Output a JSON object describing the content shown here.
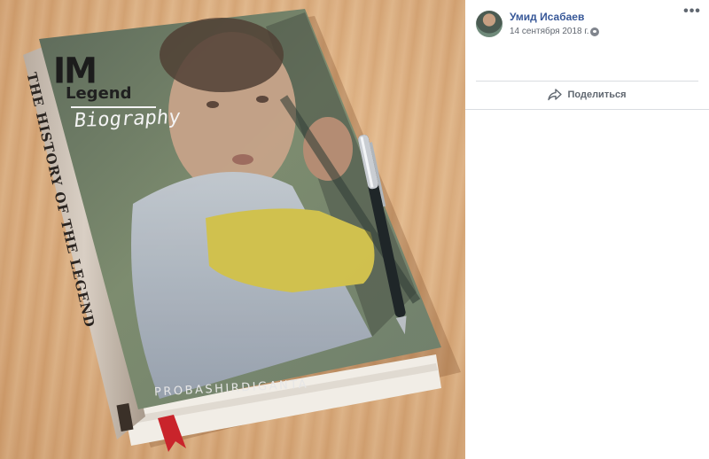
{
  "post": {
    "author": "Умид Исабаев",
    "date": "14 сентября 2018 г.",
    "share_label": "Поделиться",
    "more_icon": "more-horizontal-icon",
    "privacy_icon": "globe-icon",
    "share_icon": "share-arrow-icon"
  },
  "photo": {
    "logo_text": "IM",
    "legend_text": "Legend",
    "biography_text": "Biography",
    "spine_title": "THE HISTORY OF THE LEGEND",
    "credit_text": "PROBASHIRDIGANTA"
  },
  "colors": {
    "link": "#385898",
    "muted": "#616770",
    "bookmark": "#c9242b"
  }
}
